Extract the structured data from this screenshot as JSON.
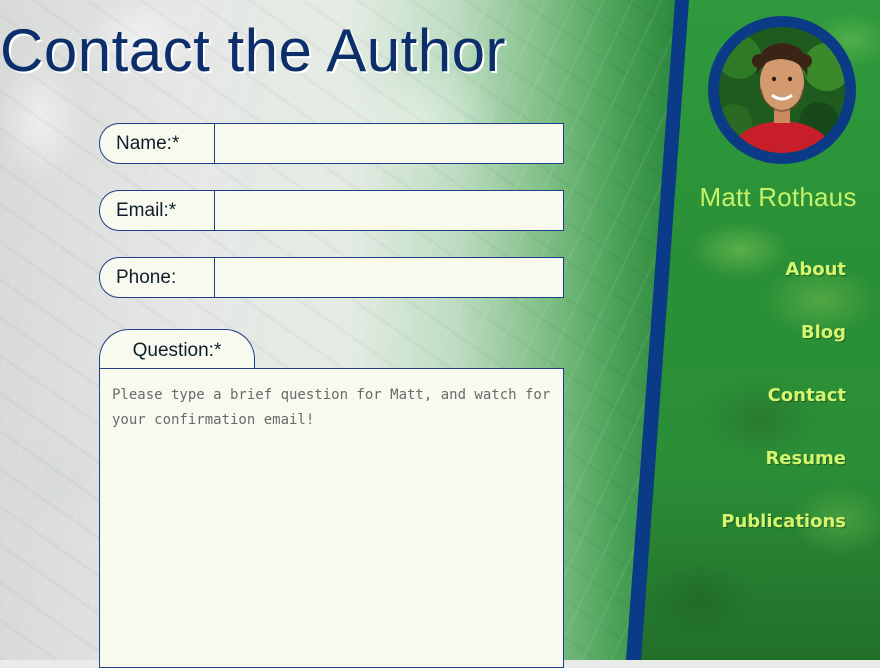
{
  "page": {
    "title": "Contact the Author"
  },
  "form": {
    "name_label": "Name:*",
    "email_label": "Email:*",
    "phone_label": "Phone:",
    "question_label": "Question:*",
    "name_value": "",
    "email_value": "",
    "phone_value": "",
    "question_placeholder": "Please type a brief question for Matt, and watch for your confirmation email!"
  },
  "sidebar": {
    "author_name": "Matt Rothaus",
    "nav": [
      {
        "label": "About"
      },
      {
        "label": "Blog"
      },
      {
        "label": "Contact"
      },
      {
        "label": "Resume"
      },
      {
        "label": "Publications"
      }
    ]
  },
  "colors": {
    "title": "#0c2f6b",
    "field_border": "#1e3f86",
    "field_bg": "#f8faf0",
    "sidebar_green": "#2b8f37",
    "divider_blue": "#0b3a86",
    "nav_text": "#d4f56e",
    "name_text": "#c6f26a"
  }
}
